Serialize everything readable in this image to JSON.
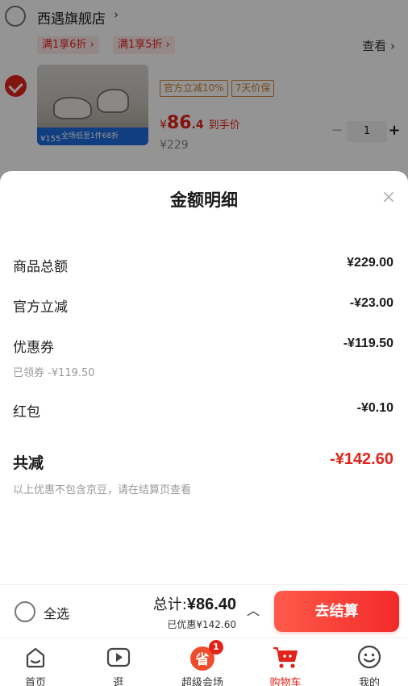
{
  "store": {
    "name": "西遇旗舰店",
    "chevron": "›"
  },
  "promos": {
    "tag1": "满1享6折 ›",
    "tag2": "满1享5折 ›",
    "view_more": "查看 ›"
  },
  "product": {
    "tags": [
      "官方立减10%",
      "7天价保"
    ],
    "price_symbol": "¥",
    "price_int": "86",
    "price_dec": ".4",
    "price_suffix": "到手价",
    "orig_price": "¥229",
    "quantity": "1",
    "minus": "−",
    "plus": "+",
    "thumb_banner": "全场低至1件68折",
    "thumb_price": "¥155"
  },
  "sheet": {
    "title": "金额明细",
    "close": "×",
    "lines": [
      {
        "label": "商品总额",
        "value": "¥229.00"
      },
      {
        "label": "官方立减",
        "value": "-¥23.00"
      },
      {
        "label": "优惠券",
        "value": "-¥119.50",
        "note": "已领券 -¥119.50"
      },
      {
        "label": "红包",
        "value": "-¥0.10"
      }
    ],
    "total_label": "共减",
    "total_value": "-¥142.60",
    "disclaimer": "以上优惠不包含京豆，请在结算页查看"
  },
  "checkout": {
    "select_all": "全选",
    "total_prefix": "总计:",
    "total_amount": "¥86.40",
    "saved": "已优惠¥142.60",
    "caret": "︿",
    "pay": "去结算"
  },
  "tabs": [
    {
      "label": "首页",
      "icon": "home-icon"
    },
    {
      "label": "逛",
      "icon": "play-icon"
    },
    {
      "label": "超级会场",
      "icon": "sheng-icon",
      "badge": "1",
      "badge_glyph": "省"
    },
    {
      "label": "购物车",
      "icon": "cart-icon",
      "active": true
    },
    {
      "label": "我的",
      "icon": "smile-icon"
    }
  ],
  "colors": {
    "accent": "#e2231a",
    "tag_border": "#c9833a",
    "pay_from": "#ff5a4a",
    "pay_to": "#f22a2a"
  }
}
